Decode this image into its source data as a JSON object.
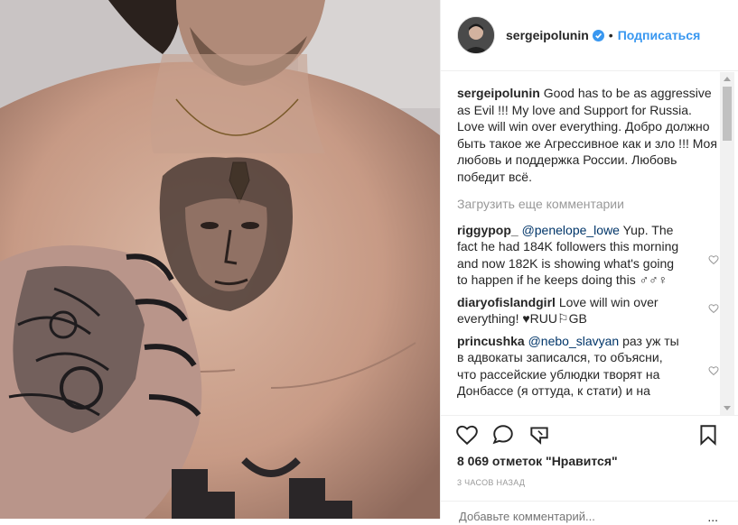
{
  "post": {
    "username": "sergeipolunin",
    "follow_label": "Подписаться",
    "separator": "•",
    "caption_text_1": "Good has to be as aggressive as Evil !!! My love and Support for Russia.",
    "caption_text_2": "Love will win over everything. Добро должно быть такое же Агрессивное как и зло !!! Моя любовь и поддержка России. Любовь победит всё."
  },
  "load_more_label": "Загрузить еще комментарии",
  "comments": [
    {
      "user": "riggypop_",
      "mention": "@penelope_lowe",
      "text": "Yup. The fact he had 184K followers this morning and now 182K is showing what's going to happen if he keeps doing this ♂♂♀"
    },
    {
      "user": "diaryofislandgirl",
      "mention": "",
      "text": "Love will win over everything! ♥RUU⚐GB"
    },
    {
      "user": "princushka",
      "mention": "@nebo_slavyan",
      "text": "раз уж ты в адвокаты записался, то объясни, что рассейские ублюдки творят на Донбассе (я оттуда, к стати) и на"
    }
  ],
  "likes_label": "8 069 отметок \"Нравится\"",
  "timestamp": "3 ЧАСОВ НАЗАД",
  "add_comment_placeholder": "Добавьте комментарий...",
  "more_label": "...",
  "icons": [
    "verified-icon",
    "heart-icon",
    "comment-icon",
    "share-icon",
    "bookmark-icon"
  ],
  "colors": {
    "link": "#3897f0",
    "verified": "#3897f0",
    "muted": "#999999"
  }
}
